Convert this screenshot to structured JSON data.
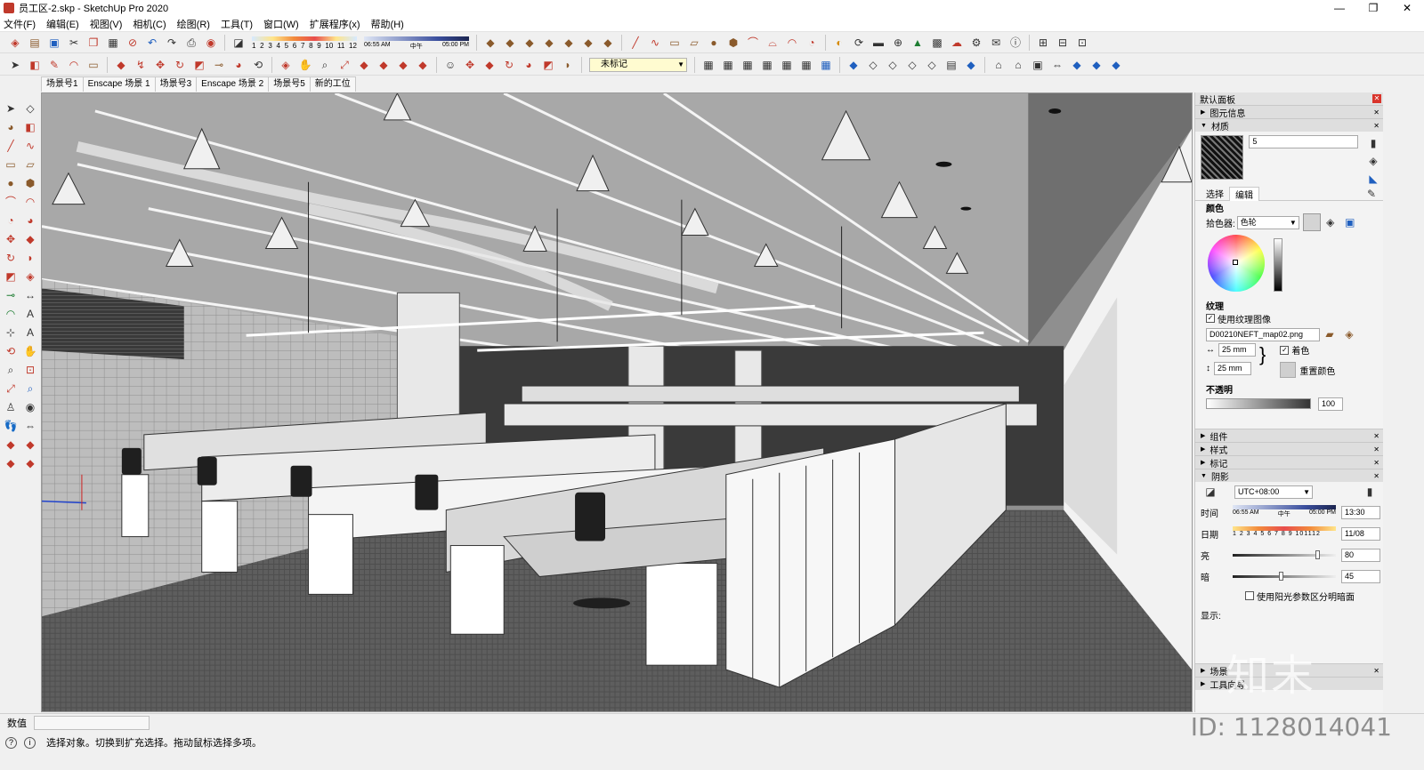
{
  "window": {
    "title": "员工区-2.skp - SketchUp Pro 2020",
    "controls": [
      "—",
      "❐",
      "✕"
    ]
  },
  "menu": [
    "文件(F)",
    "编辑(E)",
    "视图(V)",
    "相机(C)",
    "绘图(R)",
    "工具(T)",
    "窗口(W)",
    "扩展程序(x)",
    "帮助(H)"
  ],
  "shadow_toolbar": {
    "months": [
      "1",
      "2",
      "3",
      "4",
      "5",
      "6",
      "7",
      "8",
      "9",
      "10",
      "11",
      "12"
    ],
    "time_start": "06:55 AM",
    "time_mid": "中午",
    "time_end": "05:00 PM"
  },
  "tag_select": {
    "value": "未标记"
  },
  "scenes": [
    "场景号1",
    "Enscape 场景 1",
    "场景号3",
    "Enscape 场景 2",
    "场景号5",
    "新的工位"
  ],
  "tray": {
    "title": "默认面板",
    "sections": {
      "entity_info": "图元信息",
      "materials": "材质",
      "components": "组件",
      "styles": "样式",
      "tags": "标记",
      "shadows": "阴影",
      "scenes": "场景",
      "extra": "工具向导"
    },
    "material": {
      "name": "5",
      "tab_select": "选择",
      "tab_edit": "编辑",
      "color_heading": "颜色",
      "picker_label": "拾色器:",
      "picker_value": "色轮",
      "texture_heading": "纹理",
      "use_texture_label": "使用纹理图像",
      "texture_file": "D00210NEFT_map02.png",
      "width": "25 mm",
      "height": "25 mm",
      "colorize_label": "着色",
      "reset_color_label": "重置颜色",
      "opacity_heading": "不透明",
      "opacity": "100"
    },
    "shadows": {
      "timezone": "UTC+08:00",
      "time_label": "时间",
      "time_start": "06:55 AM",
      "time_mid": "中午",
      "time_end": "05:00 PM",
      "time_value": "13:30",
      "date_label": "日期",
      "months": "1 2 3 4 5 6 7 8 9 101112",
      "date_value": "11/08",
      "light_label": "亮",
      "light_value": "80",
      "light_level": 0.8,
      "dark_label": "暗",
      "dark_value": "45",
      "dark_level": 0.45,
      "sun_shading_label": "使用阳光参数区分明暗面",
      "display_label": "显示:"
    }
  },
  "status": {
    "value_label": "数值",
    "hint": "选择对象。切换到扩充选择。拖动鼠标选择多项。"
  },
  "watermark": {
    "logo": "知末",
    "id": "ID: 1128014041"
  }
}
